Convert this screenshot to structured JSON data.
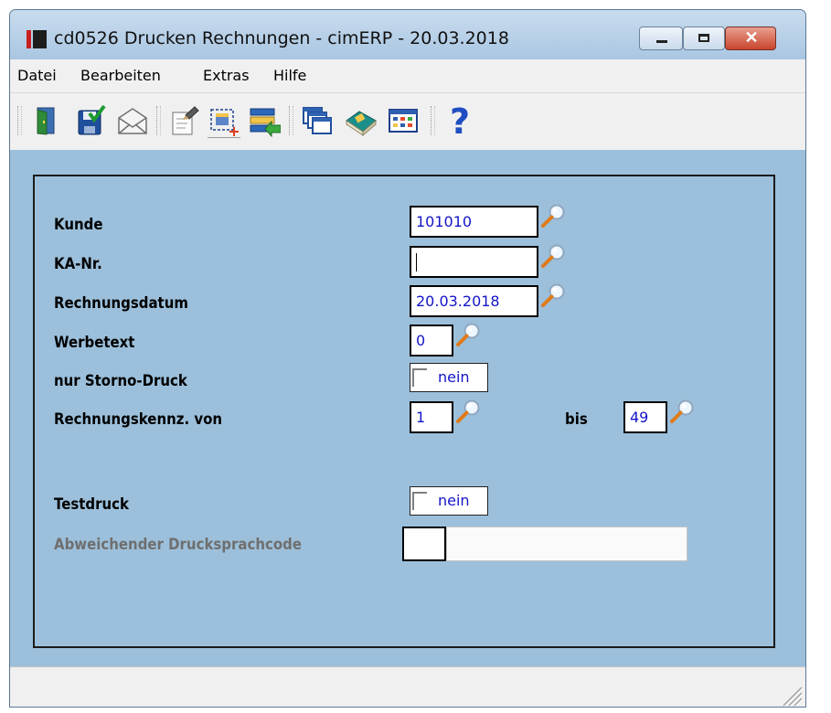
{
  "window": {
    "title": "cd0526 Drucken Rechnungen - cimERP - 20.03.2018"
  },
  "menu": [
    "Datei",
    "Bearbeiten",
    "Extras",
    "Hilfe"
  ],
  "toolbar": {
    "icons": [
      "exit-door-icon",
      "save-check-icon",
      "mail-envelope-icon",
      "edit-document-icon",
      "select-area-icon",
      "transfer-list-icon",
      "windows-icon",
      "book-icon",
      "table-icon",
      "help-icon"
    ],
    "active": "select-area-icon"
  },
  "form": {
    "kunde": {
      "label": "Kunde",
      "value": "101010"
    },
    "ka_nr": {
      "label": "KA-Nr.",
      "value": ""
    },
    "rechnungsdatum": {
      "label": "Rechnungsdatum",
      "value": "20.03.2018"
    },
    "werbetext": {
      "label": "Werbetext",
      "value": "0"
    },
    "storno": {
      "label": "nur Storno-Druck",
      "value": "nein",
      "checked": false
    },
    "kennz": {
      "label": "Rechnungskennz. von",
      "von": "1",
      "bis_label": "bis",
      "bis": "49"
    },
    "testdruck": {
      "label": "Testdruck",
      "value": "nein",
      "checked": false
    },
    "sprachcode": {
      "label": "Abweichender Drucksprachcode",
      "value": "",
      "description": "",
      "disabled": true
    }
  },
  "colors": {
    "background": "#9cc0db",
    "value_text": "#1414c8",
    "disabled_label": "#6f6f6f",
    "close_button": "#c9452e"
  }
}
